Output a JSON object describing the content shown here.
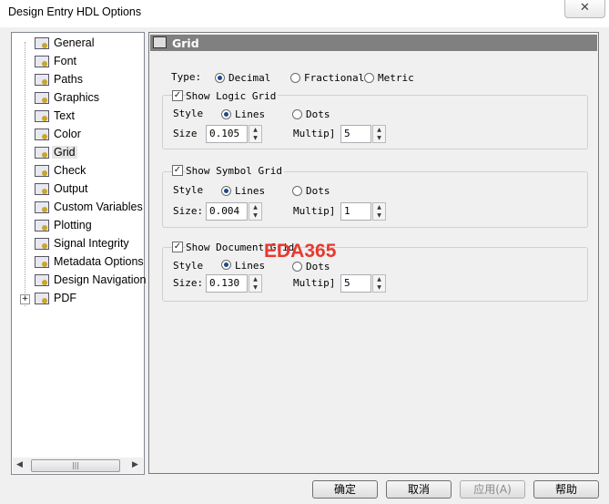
{
  "window": {
    "title": "Design Entry HDL Options",
    "close_glyph": "✕"
  },
  "tree": {
    "items": [
      {
        "label": "General",
        "icon": "options-page-icon"
      },
      {
        "label": "Font",
        "icon": "options-page-icon"
      },
      {
        "label": "Paths",
        "icon": "options-page-icon"
      },
      {
        "label": "Graphics",
        "icon": "options-page-icon"
      },
      {
        "label": "Text",
        "icon": "options-page-icon"
      },
      {
        "label": "Color",
        "icon": "options-page-icon"
      },
      {
        "label": "Grid",
        "icon": "options-page-icon",
        "selected": true
      },
      {
        "label": "Check",
        "icon": "options-page-icon"
      },
      {
        "label": "Output",
        "icon": "options-page-icon"
      },
      {
        "label": "Custom Variables",
        "icon": "options-page-icon"
      },
      {
        "label": "Plotting",
        "icon": "options-page-icon"
      },
      {
        "label": "Signal Integrity",
        "icon": "options-page-icon"
      },
      {
        "label": "Metadata Options",
        "icon": "options-page-icon"
      },
      {
        "label": "Design Navigation",
        "icon": "options-page-icon"
      },
      {
        "label": "PDF",
        "icon": "options-page-icon",
        "expandable": true
      }
    ],
    "scroll_left": "◀",
    "scroll_right": "▶",
    "thumb_grip": "|||"
  },
  "panel": {
    "title": "Grid",
    "type": {
      "label": "Type:",
      "options": [
        "Decimal",
        "Fractional",
        "Metric"
      ],
      "selected": "Decimal"
    },
    "groups": [
      {
        "checkbox_label": "Show Logic Grid",
        "checked": true,
        "style_label": "Style",
        "style_options": [
          "Lines",
          "Dots"
        ],
        "style_selected": "Lines",
        "size_label": "Size",
        "size_value": "0.105",
        "multiple_label": "Multip]",
        "multiple_value": "5"
      },
      {
        "checkbox_label": "Show Symbol Grid",
        "checked": true,
        "style_label": "Style",
        "style_options": [
          "Lines",
          "Dots"
        ],
        "style_selected": "Lines",
        "size_label": "Size:",
        "size_value": "0.004",
        "multiple_label": "Multip]",
        "multiple_value": "1"
      },
      {
        "checkbox_label": "Show Document Grid",
        "checked": true,
        "style_label": "Style",
        "style_options": [
          "Lines",
          "Dots"
        ],
        "style_selected": "Lines",
        "size_label": "Size:",
        "size_value": "0.130",
        "multiple_label": "Multip]",
        "multiple_value": "5"
      }
    ],
    "watermark": "EDA365"
  },
  "buttons": {
    "ok": "确定",
    "cancel": "取消",
    "apply": "应用(A)",
    "help": "帮助"
  },
  "spin": {
    "up": "▲",
    "down": "▼"
  },
  "check_glyph": "✓"
}
